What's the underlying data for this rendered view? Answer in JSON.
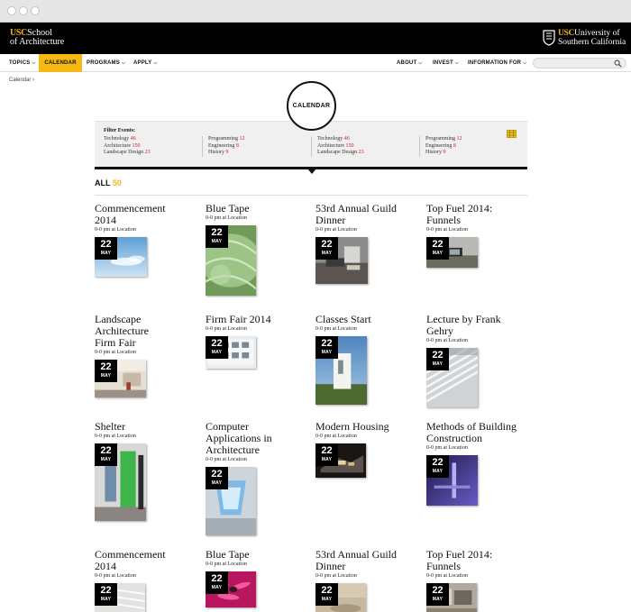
{
  "header": {
    "school_logo": {
      "usc": "USC",
      "line1": "School",
      "line2": "of Architecture"
    },
    "university_logo": {
      "usc": "USC",
      "line1": "University of",
      "line2": "Southern California"
    }
  },
  "nav": {
    "left": [
      {
        "label": "TOPICS",
        "has_chevron": true,
        "active": false
      },
      {
        "label": "CALENDAR",
        "has_chevron": false,
        "active": true
      },
      {
        "label": "PROGRAMS",
        "has_chevron": true,
        "active": false
      },
      {
        "label": "APPLY",
        "has_chevron": true,
        "active": false
      }
    ],
    "right": [
      {
        "label": "ABOUT",
        "has_chevron": true
      },
      {
        "label": "INVEST",
        "has_chevron": true
      },
      {
        "label": "INFORMATION FOR",
        "has_chevron": true
      }
    ],
    "search_placeholder": ""
  },
  "breadcrumb": {
    "label": "Calendar",
    "separator": "›"
  },
  "page_title": "CALENDAR",
  "filter": {
    "title": "Filter Events:",
    "columns": [
      [
        {
          "name": "Technology",
          "count": "46"
        },
        {
          "name": "Architecture",
          "count": "150"
        },
        {
          "name": "Landscape Design",
          "count": "23"
        }
      ],
      [
        {
          "name": "Programming",
          "count": "12"
        },
        {
          "name": "Engineering",
          "count": "8"
        },
        {
          "name": "History",
          "count": "9"
        }
      ],
      [
        {
          "name": "Technology",
          "count": "46"
        },
        {
          "name": "Architecture",
          "count": "150"
        },
        {
          "name": "Landscape Design",
          "count": "23"
        }
      ],
      [
        {
          "name": "Programming",
          "count": "12"
        },
        {
          "name": "Engineering",
          "count": "8"
        },
        {
          "name": "History",
          "count": "9"
        }
      ]
    ]
  },
  "all": {
    "label": "ALL",
    "count": "50"
  },
  "date": {
    "day": "22",
    "month": "MAY"
  },
  "events": [
    {
      "title_lines": [
        "Commencement",
        "2014"
      ],
      "meta": "0-0 pm at Location",
      "image": "sky-photo"
    },
    {
      "title_lines": [
        "Blue Tape"
      ],
      "meta": "0-0 pm at Location",
      "image": "green-texture-photo"
    },
    {
      "title_lines": [
        "53rd Annual Guild",
        "Dinner"
      ],
      "meta": "0-0 pm at Location",
      "image": "interior-photo"
    },
    {
      "title_lines": [
        "Top Fuel 2014:",
        "Funnels"
      ],
      "meta": "0-0 pm at Location",
      "image": "house-photo"
    },
    {
      "title_lines": [
        "Landscape",
        "Architecture",
        "Firm Fair"
      ],
      "meta": "0-0 pm at Location",
      "image": "gallery-photo"
    },
    {
      "title_lines": [
        "Firm Fair 2014"
      ],
      "meta": "0-0 pm at Location",
      "image": "facade-photo"
    },
    {
      "title_lines": [
        "Classes Start"
      ],
      "meta": "0-0 pm at Location",
      "image": "white-tower-photo"
    },
    {
      "title_lines": [
        "Lecture by Frank",
        "Gehry"
      ],
      "meta": "0-0 pm at Location",
      "image": "stairs-photo"
    },
    {
      "title_lines": [
        "Shelter"
      ],
      "meta": "0-0 pm at Location",
      "image": "green-wall-photo"
    },
    {
      "title_lines": [
        "Computer",
        "Applications in",
        "Architecture"
      ],
      "meta": "0-0 pm at Location",
      "image": "skylight-photo"
    },
    {
      "title_lines": [
        "Modern Housing"
      ],
      "meta": "0-0 pm at Location",
      "image": "night-photo"
    },
    {
      "title_lines": [
        "Methods of Building",
        "Construction"
      ],
      "meta": "0-0 pm at Location",
      "image": "purple-hall-photo"
    },
    {
      "title_lines": [
        "Commencement",
        "2014"
      ],
      "meta": "0-0 pm at Location",
      "image": "ceiling-photo"
    },
    {
      "title_lines": [
        "Blue Tape"
      ],
      "meta": "0-0 pm at Location",
      "image": "pink-flower-photo"
    },
    {
      "title_lines": [
        "53rd Annual Guild",
        "Dinner"
      ],
      "meta": "0-0 pm at Location",
      "image": "beige-photo"
    },
    {
      "title_lines": [
        "Top Fuel 2014:",
        "Funnels"
      ],
      "meta": "0-0 pm at Location",
      "image": "room-photo"
    }
  ],
  "colors": {
    "accent": "#f6b813",
    "brand_gold": "#f2b81c",
    "filter_count": "#d0181c",
    "header_bg": "#000000"
  }
}
